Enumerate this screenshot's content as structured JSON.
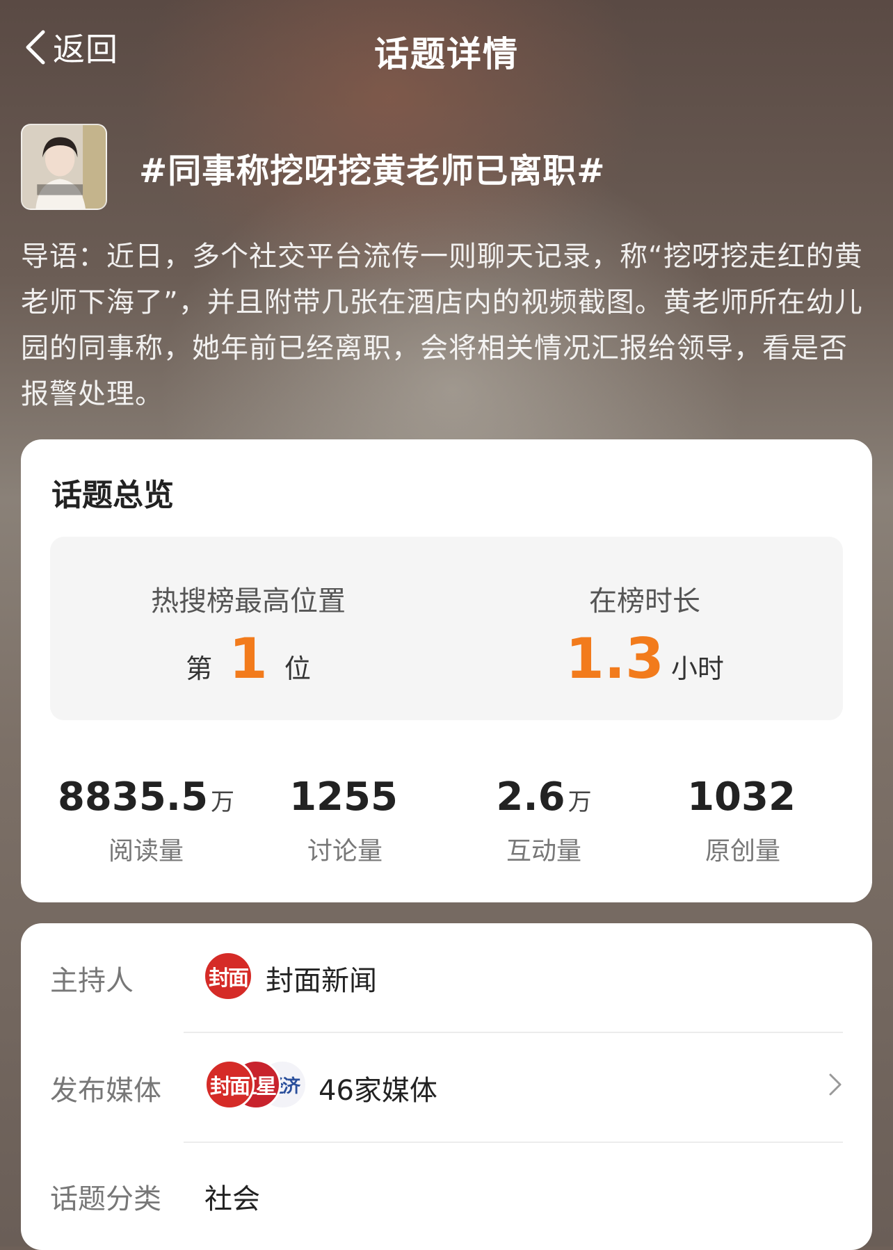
{
  "header": {
    "back_label": "返回",
    "title": "话题详情"
  },
  "topic": {
    "title": "#同事称挖呀挖黄老师已离职#",
    "intro": "导语：近日，多个社交平台流传一则聊天记录，称“挖呀挖走红的黄老师下海了”，并且附带几张在酒店内的视频截图。黄老师所在幼儿园的同事称，她年前已经离职，会将相关情况汇报给领导，看是否报警处理。"
  },
  "overview": {
    "title": "话题总览",
    "rank": {
      "label": "热搜榜最高位置",
      "prefix": "第",
      "value": "1",
      "suffix": "位"
    },
    "duration": {
      "label": "在榜时长",
      "value": "1.3",
      "unit": "小时"
    },
    "stats": [
      {
        "value": "8835.5",
        "unit": "万",
        "label": "阅读量"
      },
      {
        "value": "1255",
        "unit": "",
        "label": "讨论量"
      },
      {
        "value": "2.6",
        "unit": "万",
        "label": "互动量"
      },
      {
        "value": "1032",
        "unit": "",
        "label": "原创量"
      }
    ]
  },
  "info": {
    "host": {
      "label": "主持人",
      "value": "封面新闻",
      "logo_text": "封面"
    },
    "media": {
      "label": "发布媒体",
      "value": "46家媒体",
      "logos": [
        "封面",
        "红星",
        "经济"
      ]
    },
    "category": {
      "label": "话题分类",
      "value": "社会"
    }
  },
  "colors": {
    "accent": "#f27b1c",
    "logo_red": "#d52b27"
  }
}
